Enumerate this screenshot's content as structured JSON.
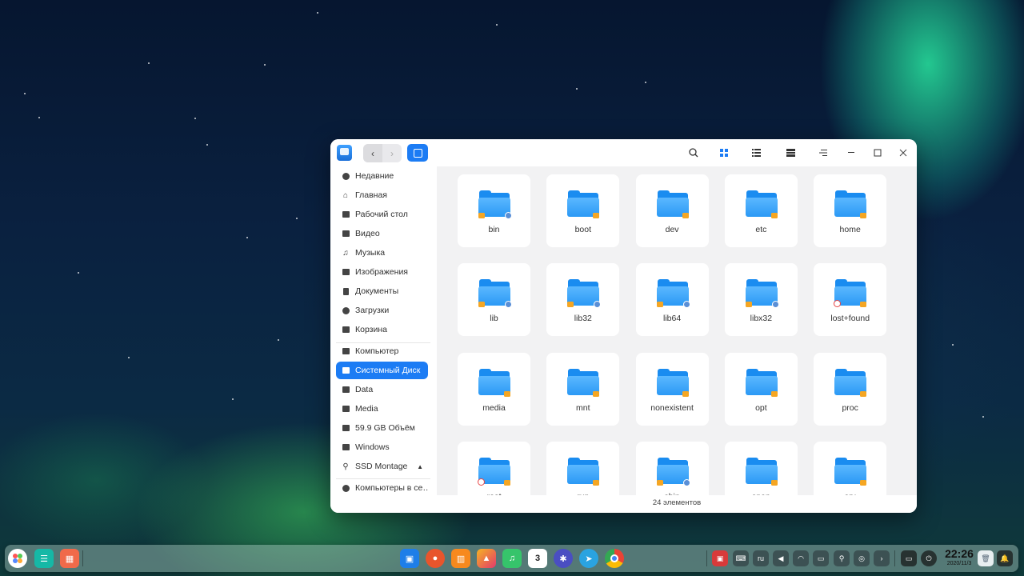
{
  "window": {
    "sidebar": {
      "items": [
        {
          "label": "Недавние",
          "icon": "clock-icon"
        },
        {
          "label": "Главная",
          "icon": "home-icon"
        },
        {
          "label": "Рабочий стол",
          "icon": "desktop-icon"
        },
        {
          "label": "Видео",
          "icon": "video-icon"
        },
        {
          "label": "Музыка",
          "icon": "music-icon"
        },
        {
          "label": "Изображения",
          "icon": "image-icon"
        },
        {
          "label": "Документы",
          "icon": "document-icon"
        },
        {
          "label": "Загрузки",
          "icon": "download-icon"
        },
        {
          "label": "Корзина",
          "icon": "trash-icon"
        },
        {
          "label": "Компьютер",
          "icon": "computer-icon"
        },
        {
          "label": "Системный Диск",
          "icon": "disk-icon",
          "active": true
        },
        {
          "label": "Data",
          "icon": "disk-icon"
        },
        {
          "label": "Media",
          "icon": "disk-icon"
        },
        {
          "label": "59.9 GB Объём",
          "icon": "disk-icon"
        },
        {
          "label": "Windows",
          "icon": "disk-icon"
        },
        {
          "label": "SSD Montage",
          "icon": "usb-icon"
        },
        {
          "label": "Компьютеры в се…",
          "icon": "network-icon"
        }
      ]
    },
    "files": [
      {
        "name": "bin"
      },
      {
        "name": "boot"
      },
      {
        "name": "dev"
      },
      {
        "name": "etc"
      },
      {
        "name": "home"
      },
      {
        "name": "lib"
      },
      {
        "name": "lib32"
      },
      {
        "name": "lib64"
      },
      {
        "name": "libx32"
      },
      {
        "name": "lost+found"
      },
      {
        "name": "media"
      },
      {
        "name": "mnt"
      },
      {
        "name": "nonexistent"
      },
      {
        "name": "opt"
      },
      {
        "name": "proc"
      },
      {
        "name": "root"
      },
      {
        "name": "run"
      },
      {
        "name": "sbin"
      },
      {
        "name": "snap"
      },
      {
        "name": "srv"
      }
    ],
    "status": {
      "count_text": "24 элементов"
    }
  },
  "dock": {
    "clock_time": "22:26",
    "clock_date": "2020/11/3",
    "lang": "ru",
    "calendar_day": "3"
  },
  "colors": {
    "accent": "#1c7cf4",
    "folder": "#2b99f5",
    "lock": "#f5a623"
  }
}
